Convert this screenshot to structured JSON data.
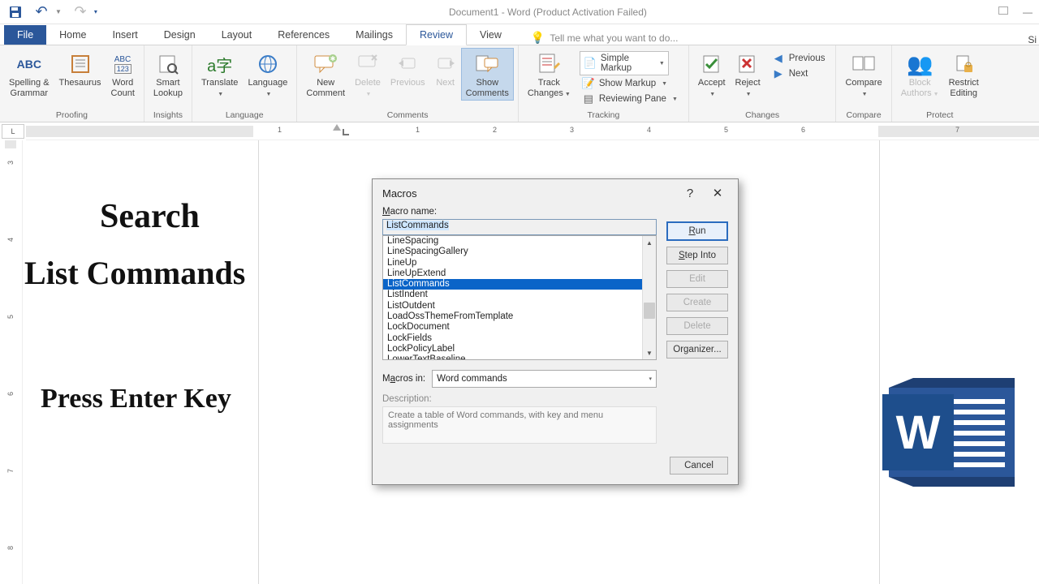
{
  "titlebar": {
    "title": "Document1 - Word (Product Activation Failed)"
  },
  "tabs": {
    "file": "File",
    "items": [
      "Home",
      "Insert",
      "Design",
      "Layout",
      "References",
      "Mailings",
      "Review",
      "View"
    ],
    "active": "Review",
    "tell_me": "Tell me what you want to do..."
  },
  "ribbon": {
    "proofing": {
      "label": "Proofing",
      "spell": "Spelling &\nGrammar",
      "thesaurus": "Thesaurus",
      "wc": "Word\nCount"
    },
    "insights": {
      "label": "Insights",
      "smart": "Smart\nLookup"
    },
    "language": {
      "label": "Language",
      "translate": "Translate",
      "language": "Language"
    },
    "comments": {
      "label": "Comments",
      "new": "New\nComment",
      "delete": "Delete",
      "previous": "Previous",
      "next": "Next",
      "show": "Show\nComments"
    },
    "tracking": {
      "label": "Tracking",
      "track": "Track\nChanges",
      "simple": "Simple Markup",
      "showm": "Show Markup",
      "pane": "Reviewing Pane"
    },
    "changes": {
      "label": "Changes",
      "accept": "Accept",
      "reject": "Reject",
      "previous": "Previous",
      "next": "Next"
    },
    "compare": {
      "label": "Compare",
      "compare": "Compare"
    },
    "protect": {
      "label": "Protect",
      "block": "Block\nAuthors",
      "restrict": "Restrict\nEditing"
    }
  },
  "annotations": {
    "search": "Search",
    "list": "List Commands",
    "press": "Press Enter Key"
  },
  "dialog": {
    "title": "Macros",
    "macro_name_label": "Macro name:",
    "macro_name_value": "ListCommands",
    "list": [
      "LineSpacing",
      "LineSpacingGallery",
      "LineUp",
      "LineUpExtend",
      "ListCommands",
      "ListIndent",
      "ListOutdent",
      "LoadOssThemeFromTemplate",
      "LockDocument",
      "LockFields",
      "LockPolicyLabel",
      "LowerTextBaseline"
    ],
    "selected": "ListCommands",
    "macros_in_label": "Macros in:",
    "macros_in_value": "Word commands",
    "description_label": "Description:",
    "description_value": "Create a table of Word commands, with key and menu assignments",
    "buttons": {
      "run": "Run",
      "step": "Step Into",
      "edit": "Edit",
      "create": "Create",
      "delete": "Delete",
      "org": "Organizer...",
      "cancel": "Cancel"
    }
  },
  "sig": "Si"
}
